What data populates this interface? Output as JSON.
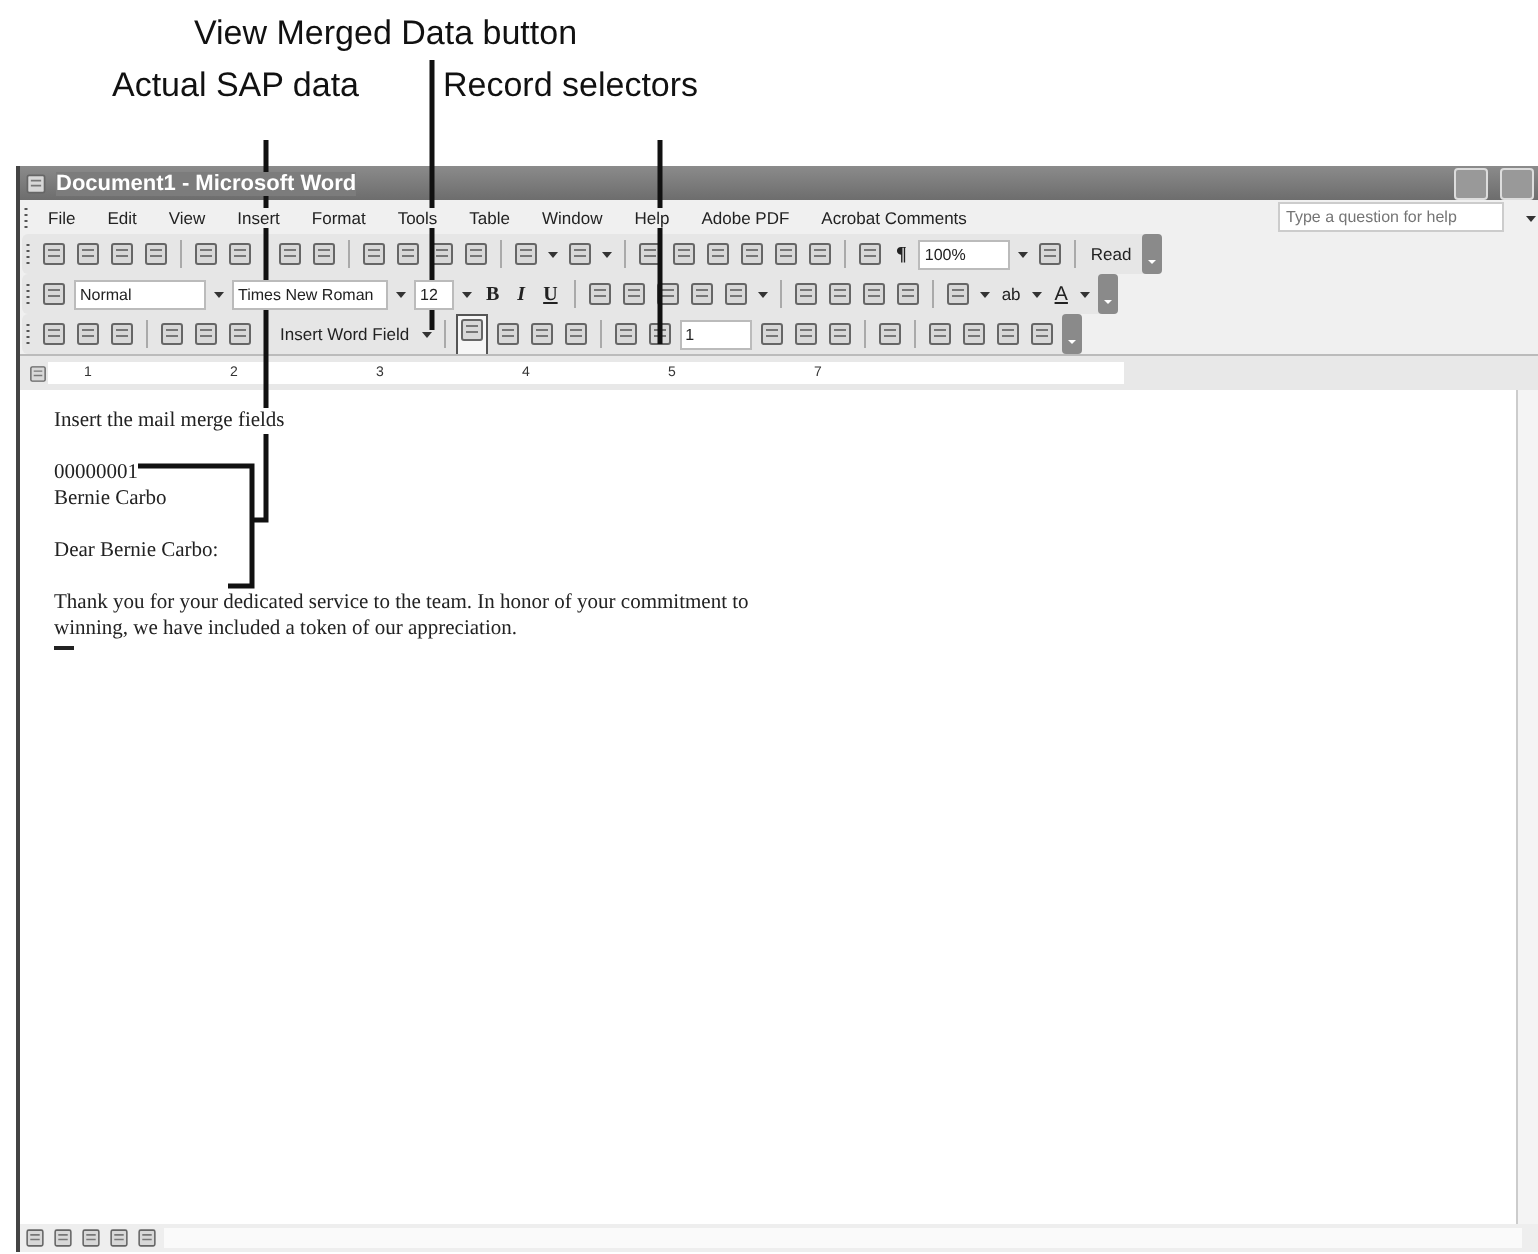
{
  "callouts": [
    {
      "label": "View Merged Data button"
    },
    {
      "label": "Actual SAP data"
    },
    {
      "label": "Record selectors"
    }
  ],
  "window": {
    "title": "Document1 - Microsoft Word"
  },
  "menu": [
    "File",
    "Edit",
    "View",
    "Insert",
    "Format",
    "Tools",
    "Table",
    "Window",
    "Help",
    "Adobe PDF",
    "Acrobat Comments"
  ],
  "help_box": {
    "placeholder": "Type a question for help"
  },
  "standard_toolbar": {
    "zoom": "100%",
    "show_formatting": "¶",
    "read": "Read"
  },
  "formatting_toolbar": {
    "style": "Normal",
    "font": "Times New Roman",
    "size": "12",
    "format_buttons": [
      "B",
      "I",
      "U"
    ],
    "highlight": "ab",
    "font_color": "A"
  },
  "mail_merge_toolbar": {
    "insert_field": "Insert Word Field",
    "record": "1"
  },
  "ruler": [
    "1",
    "2",
    "3",
    "4",
    "5",
    "7"
  ],
  "document": [
    {
      "lines": [
        "Insert the mail merge fields"
      ]
    },
    {
      "lines": [
        "00000001",
        "Bernie Carbo"
      ]
    },
    {
      "lines": [
        "Dear Bernie Carbo:"
      ]
    },
    {
      "lines": [
        "Thank you for your dedicated service to the team.  In honor of your commitment to",
        "winning, we have included a token of our appreciation."
      ]
    }
  ]
}
